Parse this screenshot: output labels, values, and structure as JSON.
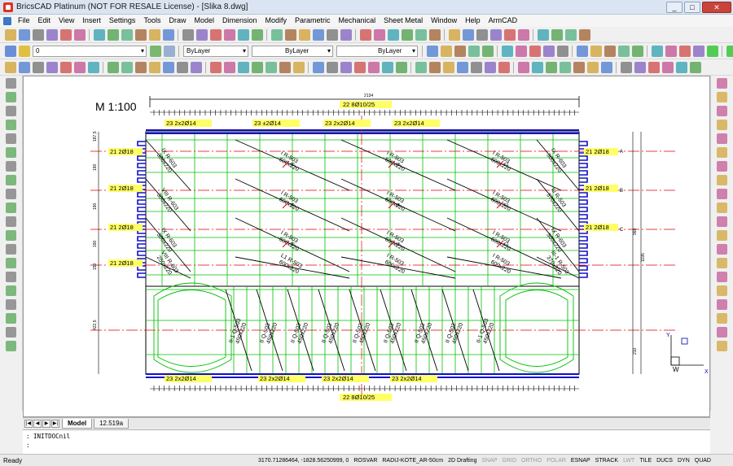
{
  "window": {
    "title": "BricsCAD Platinum (NOT FOR RESALE License) - [Slika 8.dwg]",
    "minimize": "_",
    "maximize": "□",
    "close": "✕"
  },
  "menu": [
    "File",
    "Edit",
    "View",
    "Insert",
    "Settings",
    "Tools",
    "Draw",
    "Model",
    "Dimension",
    "Modify",
    "Parametric",
    "Mechanical",
    "Sheet Metal",
    "Window",
    "Help",
    "ArmCAD"
  ],
  "props": {
    "layer": "0",
    "color": "ByLayer",
    "linetype": "ByLayer",
    "lineweight": "ByLayer"
  },
  "drawing": {
    "scale_label": "M 1:100",
    "top_dim": "2134",
    "top_rebar": "22 8Ø10/25",
    "bottom_rebar": "22 8Ø10/25",
    "top_bar_labels": [
      "23 2x2Ø14",
      "23 ±2Ø14",
      "23 2x2Ø14",
      "23 2x2Ø14"
    ],
    "bottom_bar_labels": [
      "23 2x2Ø14",
      "23 2x2Ø14",
      "23 2x2Ø14",
      "23 2x2Ø14"
    ],
    "left_labels": [
      "21 2Ø18",
      "21 2Ø18",
      "21 2Ø18",
      "21 2Ø18"
    ],
    "right_labels": [
      "21 2Ø18",
      "21 2Ø18",
      "21 2Ø18"
    ],
    "axis_labels": [
      "A",
      "B",
      "C"
    ],
    "diag_elements": [
      {
        "name": "IX R-603",
        "size": "300x220"
      },
      {
        "name": "I R-503",
        "size": "600x220"
      },
      {
        "name": "I R-503",
        "size": "600x220"
      },
      {
        "name": "I R-503",
        "size": "600x220"
      },
      {
        "name": "IX R-603",
        "size": "300x220"
      },
      {
        "name": "VIII R-603",
        "size": "300x220"
      },
      {
        "name": "I R-503",
        "size": "600x220"
      },
      {
        "name": "I R-503",
        "size": "600x220"
      },
      {
        "name": "I R-503",
        "size": "600x220"
      },
      {
        "name": "III R-503",
        "size": "370x220"
      },
      {
        "name": "IX R-603",
        "size": "300x220"
      },
      {
        "name": "I R-503",
        "size": "600x220"
      },
      {
        "name": "I R-503",
        "size": "600x220"
      },
      {
        "name": "I R-503",
        "size": "600x220"
      },
      {
        "name": "IX R-603",
        "size": "300x220"
      },
      {
        "name": "VIII R-603",
        "size": "250x220"
      },
      {
        "name": "L1 R-503",
        "size": "600x220"
      },
      {
        "name": "I R-503",
        "size": "600x220"
      },
      {
        "name": "I R-503",
        "size": "600x220"
      },
      {
        "name": "III-1 R-503",
        "size": "370x220"
      }
    ],
    "lower_elements": [
      {
        "name": "II-1 Q-503",
        "size": "450x220"
      },
      {
        "name": "II Q-503",
        "size": "450x220"
      },
      {
        "name": "II Q-503",
        "size": "450x220"
      },
      {
        "name": "II Q-503",
        "size": "450x220"
      },
      {
        "name": "II Q-503",
        "size": "450x220"
      },
      {
        "name": "II Q-503",
        "size": "450x220"
      },
      {
        "name": "II Q-503",
        "size": "450x220"
      },
      {
        "name": "II Q-503",
        "size": "450x220"
      },
      {
        "name": "II-1 Q-503",
        "size": "450x220"
      }
    ],
    "left_dims": [
      "187,5",
      "190",
      "190",
      "190",
      "150",
      "422,5"
    ],
    "right_dims": [
      "1195",
      "960",
      "210"
    ],
    "mid_marks": [
      "70",
      "65",
      "61",
      "70",
      "65",
      "61",
      "70",
      "65",
      "61"
    ],
    "ucs": {
      "y": "Y",
      "x": "X",
      "w": "W"
    }
  },
  "tabs": {
    "model": "Model",
    "layout": "12.519a"
  },
  "command": {
    "line1": ": INITDOCnil",
    "line2": ":"
  },
  "status": {
    "ready": "Ready",
    "coords": "3170.71286464, -1828.56250999, 0",
    "items": [
      {
        "label": "ROSVAR",
        "on": true
      },
      {
        "label": "RADIJ-KOTE_AR-50cm",
        "on": true
      },
      {
        "label": "2D Drafting",
        "on": true
      },
      {
        "label": "SNAP",
        "on": false
      },
      {
        "label": "GRID",
        "on": false
      },
      {
        "label": "ORTHO",
        "on": false
      },
      {
        "label": "POLAR",
        "on": false
      },
      {
        "label": "ESNAP",
        "on": true
      },
      {
        "label": "STRACK",
        "on": true
      },
      {
        "label": "LWT",
        "on": false
      },
      {
        "label": "TILE",
        "on": true
      },
      {
        "label": "DUCS",
        "on": true
      },
      {
        "label": "DYN",
        "on": true
      },
      {
        "label": "QUAD",
        "on": true
      }
    ]
  },
  "colors": {
    "green": "#00c000",
    "red": "#e00000",
    "blue": "#0000c8",
    "yellow": "#ffff00",
    "dim": "#000000"
  }
}
